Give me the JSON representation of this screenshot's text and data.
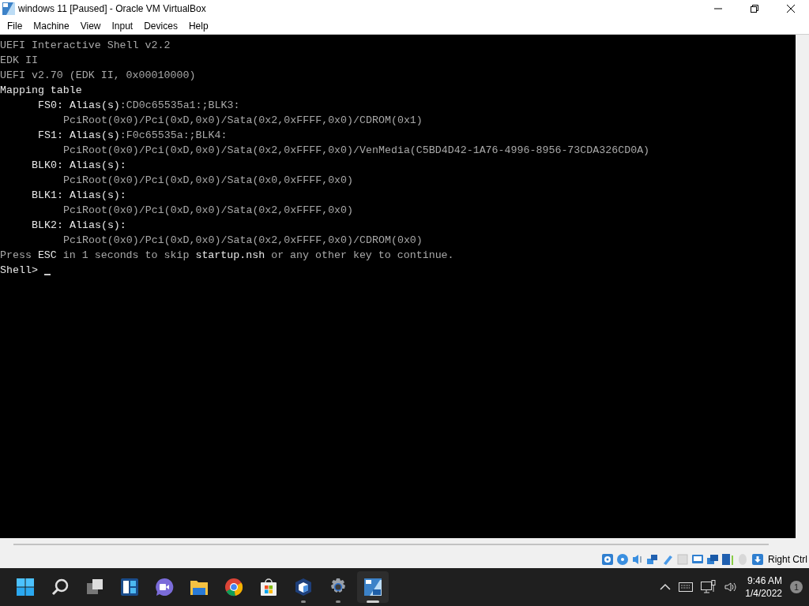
{
  "window": {
    "title": "windows 11 [Paused] - Oracle VM VirtualBox"
  },
  "menu": [
    "File",
    "Machine",
    "View",
    "Input",
    "Devices",
    "Help"
  ],
  "terminal": {
    "lines": [
      {
        "kind": "plain",
        "text": "UEFI Interactive Shell v2.2"
      },
      {
        "kind": "plain",
        "text": "EDK II"
      },
      {
        "kind": "plain",
        "text": "UEFI v2.70 (EDK II, 0x00010000)"
      },
      {
        "kind": "bright",
        "text": "Mapping table"
      },
      {
        "kind": "mapping",
        "name": "FS0:",
        "text": "**Alias(s)**:CD0c65535a1:;BLK3:"
      },
      {
        "kind": "path",
        "text": "PciRoot(0x0)/Pci(0xD,0x0)/Sata(0x2,0xFFFF,0x0)/CDROM(0x1)"
      },
      {
        "kind": "mapping",
        "name": "FS1:",
        "text": "**Alias(s)**:F0c65535a:;BLK4:"
      },
      {
        "kind": "path",
        "text": "PciRoot(0x0)/Pci(0xD,0x0)/Sata(0x2,0xFFFF,0x0)/VenMedia(C5BD4D42-1A76-4996-8956-73CDA326CD0A)"
      },
      {
        "kind": "mapping",
        "name": "BLK0:",
        "text": "**Alias(s):**"
      },
      {
        "kind": "path",
        "text": "PciRoot(0x0)/Pci(0xD,0x0)/Sata(0x0,0xFFFF,0x0)"
      },
      {
        "kind": "mapping",
        "name": "BLK1:",
        "text": "**Alias(s):**"
      },
      {
        "kind": "path",
        "text": "PciRoot(0x0)/Pci(0xD,0x0)/Sata(0x2,0xFFFF,0x0)"
      },
      {
        "kind": "mapping",
        "name": "BLK2:",
        "text": "**Alias(s):**"
      },
      {
        "kind": "path",
        "text": "PciRoot(0x0)/Pci(0xD,0x0)/Sata(0x2,0xFFFF,0x0)/CDROM(0x0)"
      },
      {
        "kind": "plain",
        "text": "Press **ESC** in 1 seconds to skip **startup.nsh** or any other key to continue."
      },
      {
        "kind": "prompt",
        "text": "Shell>"
      }
    ]
  },
  "status_bar": {
    "host_key": "Right Ctrl"
  },
  "taskbar": {
    "apps": [
      {
        "kind": "start",
        "running": false,
        "selected": false
      },
      {
        "kind": "search",
        "running": false,
        "selected": false
      },
      {
        "kind": "taskview",
        "running": false,
        "selected": false
      },
      {
        "kind": "widgets",
        "running": false,
        "selected": false
      },
      {
        "kind": "chat",
        "running": false,
        "selected": false
      },
      {
        "kind": "folder",
        "running": false,
        "selected": false
      },
      {
        "kind": "browser",
        "running": false,
        "selected": false
      },
      {
        "kind": "store",
        "running": false,
        "selected": false
      },
      {
        "kind": "cube",
        "running": true,
        "selected": false
      },
      {
        "kind": "gear",
        "running": true,
        "selected": false
      },
      {
        "kind": "vm",
        "running": true,
        "selected": true
      }
    ]
  },
  "tray": {
    "time": "9:46 AM",
    "date": "1/4/2022",
    "notifications": "1"
  }
}
